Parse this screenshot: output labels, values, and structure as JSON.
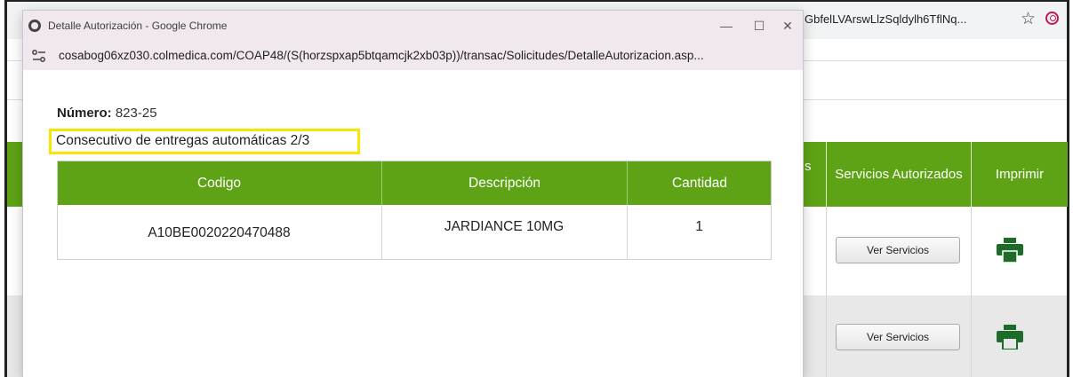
{
  "background": {
    "url_tail": "GbfelLVArswLlzSqldylh6TflNq...",
    "table": {
      "col_partial": "s",
      "col_servicios": "Servicios Autorizados",
      "col_imprimir": "Imprimir"
    },
    "rows": [
      {
        "button_label": "Ver Servicios"
      },
      {
        "button_label": "Ver Servicios"
      }
    ],
    "icons": {
      "star": "star-icon",
      "profile": "profile-icon",
      "printer": "printer-icon"
    },
    "accent_green": "#5ea316"
  },
  "popup": {
    "title": "Detalle Autorización - Google Chrome",
    "url": "cosabog06xz030.colmedica.com/COAP48/(S(horzspxap5btqamcjk2xb03p))/transac/Solicitudes/DetalleAutorizacion.asp...",
    "numero_label": "Número:",
    "numero_value": "823-25",
    "consecutivo": "Consecutivo de entregas automáticas 2/3",
    "highlight_color": "#f7e600",
    "table": {
      "headers": [
        "Codigo",
        "Descripción",
        "Cantidad"
      ],
      "rows": [
        [
          "A10BE0020220470488",
          "JARDIANCE 10MG",
          "1"
        ]
      ]
    }
  }
}
